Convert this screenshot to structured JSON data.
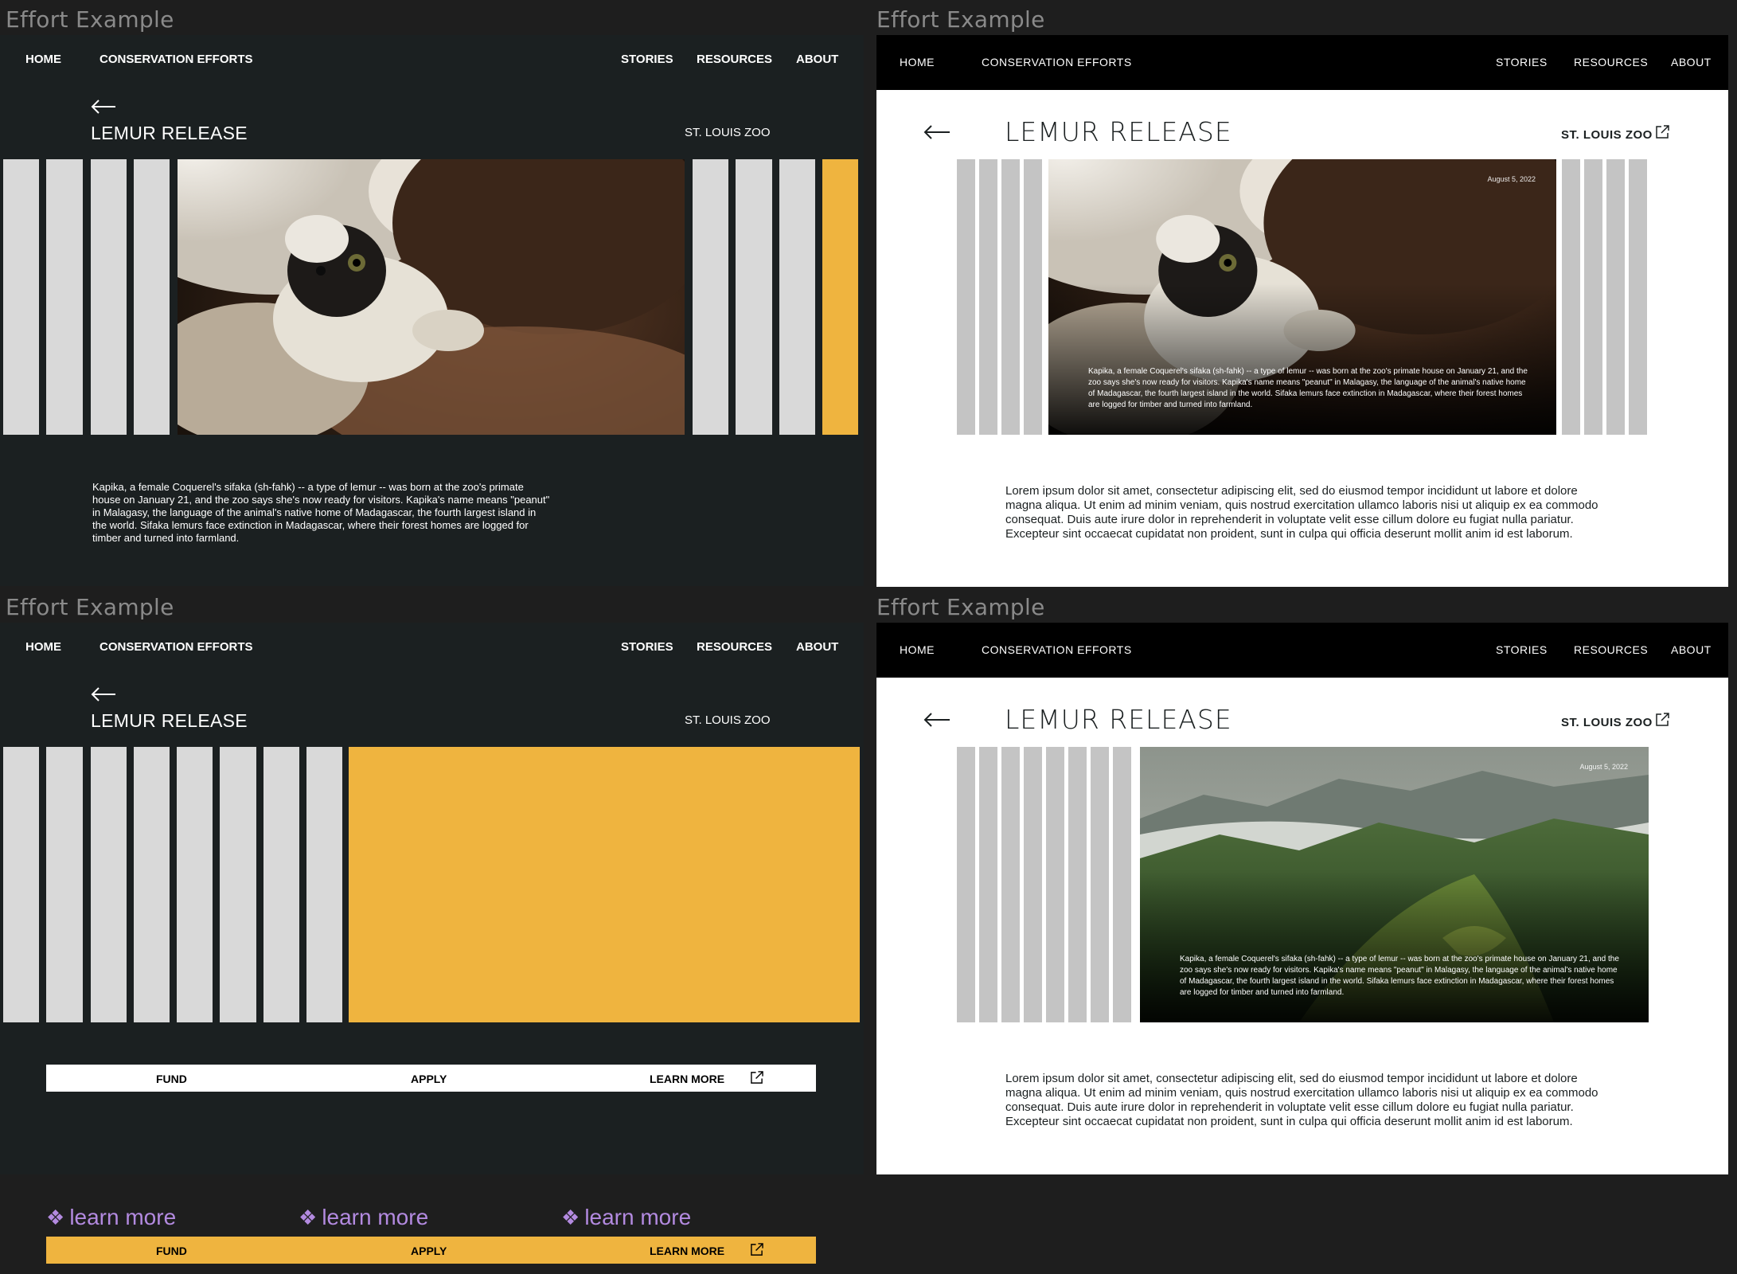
{
  "frame_label": "Effort Example",
  "nav": {
    "home": "HOME",
    "conservation": "CONSERVATION EFFORTS",
    "stories": "STORIES",
    "resources": "RESOURCES",
    "about": "ABOUT"
  },
  "page": {
    "title": "LEMUR RELEASE",
    "org": "ST. LOUIS ZOO",
    "date": "August 5, 2022"
  },
  "caption": "Kapika, a female Coquerel's sifaka (sh-fahk) -- a type of lemur -- was born at the zoo's primate house on January 21, and the zoo says she's now ready for visitors. Kapika's name means \"peanut\" in Malagasy, the language of the animal's native home of Madagascar, the fourth largest island in the world. Sifaka lemurs face extinction in Madagascar, where their forest homes are logged for timber and turned into farmland.",
  "lorem": "Lorem ipsum dolor sit amet, consectetur adipiscing elit, sed do eiusmod tempor incididunt ut labore et dolore magna aliqua. Ut enim ad minim veniam, quis nostrud exercitation ullamco laboris nisi ut aliquip ex ea commodo consequat. Duis aute irure dolor in reprehenderit in voluptate velit esse cillum dolore eu fugiat nulla pariatur. Excepteur sint occaecat cupidatat non proident, sunt in culpa qui officia deserunt mollit anim id est laborum.",
  "actions": {
    "fund": "FUND",
    "apply": "APPLY",
    "learn_more": "LEARN MORE"
  },
  "learn_links": [
    "learn more",
    "learn more",
    "learn more"
  ],
  "colors": {
    "dark_bg": "#1b2021",
    "accent": "#efb43f",
    "bar_light": "#d9d9d9",
    "bar_grey": "#c4c4c4",
    "link_purple": "#b38ae0"
  },
  "icons": [
    "back-arrow-icon",
    "external-link-icon",
    "diamond-icon"
  ]
}
